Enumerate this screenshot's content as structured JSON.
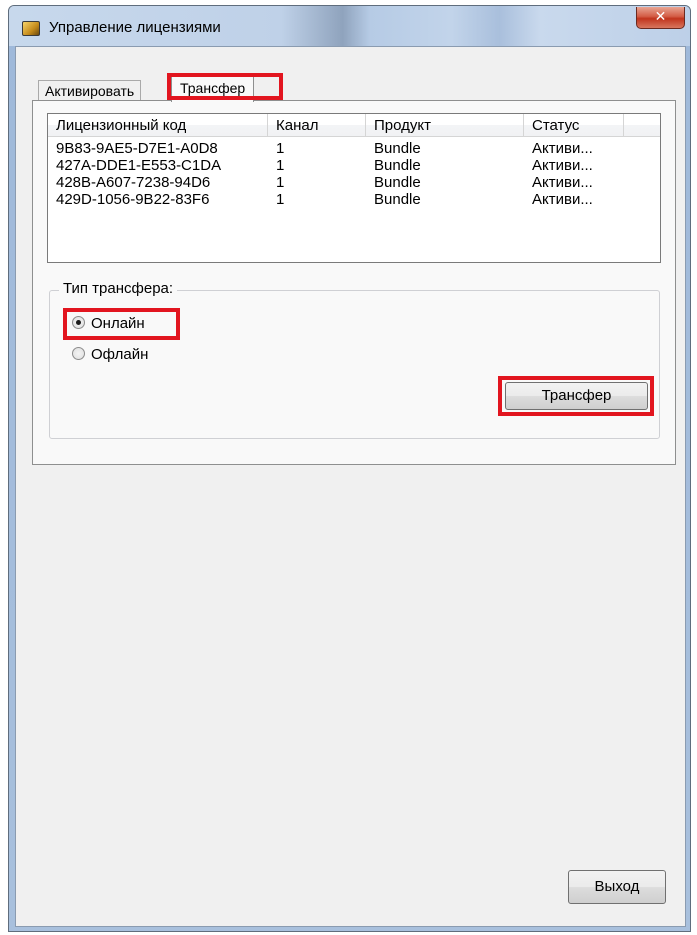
{
  "window": {
    "title": "Управление лицензиями",
    "close_glyph": "✕",
    "icon": "app-icon"
  },
  "tabs": [
    {
      "label": "Активировать",
      "selected": false
    },
    {
      "label": "Трансфер",
      "selected": true
    }
  ],
  "license_list": {
    "columns": [
      "Лицензионный код",
      "Канал",
      "Продукт",
      "Статус"
    ],
    "rows": [
      {
        "code": "9B83-9AE5-D7E1-A0D8",
        "channel": "1",
        "product": "Bundle",
        "status": "Активи..."
      },
      {
        "code": "427A-DDE1-E553-C1DA",
        "channel": "1",
        "product": "Bundle",
        "status": "Активи..."
      },
      {
        "code": "428B-A607-7238-94D6",
        "channel": "1",
        "product": "Bundle",
        "status": "Активи..."
      },
      {
        "code": "429D-1056-9B22-83F6",
        "channel": "1",
        "product": "Bundle",
        "status": "Активи..."
      }
    ]
  },
  "transfer_type": {
    "label": "Тип трансфера:",
    "options": [
      {
        "label": "Онлайн",
        "checked": true
      },
      {
        "label": "Офлайн",
        "checked": false
      }
    ]
  },
  "buttons": {
    "transfer": "Трансфер",
    "exit": "Выход"
  },
  "highlight_color": "#e2151f"
}
